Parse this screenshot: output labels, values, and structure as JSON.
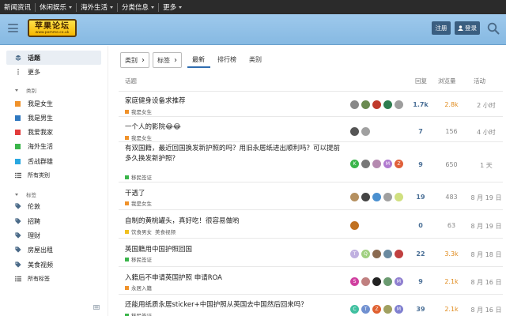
{
  "topnav": {
    "items": [
      {
        "label": "新闻资讯"
      },
      {
        "label": "休闲娱乐"
      },
      {
        "label": "海外生活"
      },
      {
        "label": "分类信息"
      },
      {
        "label": "更多"
      }
    ]
  },
  "header": {
    "logo_text": "苹果论坛",
    "logo_sub": "www.pomme.co.uk",
    "register_label": "注册",
    "login_label": "登录"
  },
  "sidebar": {
    "topics": "话题",
    "more": "更多",
    "categories_head": "类别",
    "categories": [
      {
        "label": "我是女生",
        "color": "#f0922b"
      },
      {
        "label": "我是男生",
        "color": "#2f78c0"
      },
      {
        "label": "我爱我家",
        "color": "#e23b3b"
      },
      {
        "label": "海外生活",
        "color": "#3ab54a"
      },
      {
        "label": "舌战群雄",
        "color": "#28a7e0"
      }
    ],
    "all_categories": "所有类别",
    "tags_head": "标签",
    "tags": [
      {
        "label": "伦敦"
      },
      {
        "label": "招聘"
      },
      {
        "label": "理财"
      },
      {
        "label": "房屋出租"
      },
      {
        "label": "美食视频"
      }
    ],
    "all_tags": "所有标签"
  },
  "filters": {
    "category_label": "类别",
    "tags_label": "标签"
  },
  "tabs": [
    {
      "label": "最新"
    },
    {
      "label": "排行榜"
    },
    {
      "label": "类别"
    }
  ],
  "table": {
    "headers": {
      "topic": "话题",
      "replies": "回复",
      "views": "浏览量",
      "activity": "活动"
    },
    "rows": [
      {
        "title": "家庭健身设备求推荐",
        "tags": [
          {
            "label": "我是女生",
            "color": "#f0922b"
          }
        ],
        "replies": "1.7k",
        "views": "2.8k",
        "views_hot": true,
        "activity": "2 小时",
        "avatars": [
          {
            "icon": "avatar-photo",
            "color": "#888"
          },
          {
            "icon": "avatar-photo",
            "color": "#6a8a50"
          },
          {
            "icon": "avatar-photo",
            "color": "#c0392b"
          },
          {
            "icon": "avatar-photo",
            "color": "#2e7d4f"
          },
          {
            "icon": "avatar-photo",
            "color": "#9e9e9e"
          }
        ]
      },
      {
        "title": "一个人的影院😂😂",
        "tags": [
          {
            "label": "我是女生",
            "color": "#f0922b"
          }
        ],
        "replies": "7",
        "views": "156",
        "views_hot": false,
        "activity": "4 小时",
        "avatars": [
          {
            "icon": "avatar-photo",
            "color": "#555"
          },
          {
            "icon": "avatar-photo",
            "color": "#a0a0a0"
          }
        ]
      },
      {
        "title": "有双国籍，最近回国换发新护照的吗？用旧永居纸进出顺利吗？可以提前多久换发新护照？",
        "tags": [
          {
            "label": "移民签证",
            "color": "#3ab54a"
          }
        ],
        "replies": "9",
        "views": "650",
        "views_hot": false,
        "activity": "1 天",
        "avatars": [
          {
            "letter": "K",
            "color": "#3ab54a"
          },
          {
            "icon": "avatar-photo",
            "color": "#777"
          },
          {
            "icon": "avatar-photo",
            "color": "#b58ab0"
          },
          {
            "letter": "M",
            "color": "#b07ad0"
          },
          {
            "letter": "Z",
            "color": "#e0603a"
          }
        ]
      },
      {
        "title": "干透了",
        "tags": [
          {
            "label": "我是女生",
            "color": "#f0922b"
          }
        ],
        "replies": "19",
        "views": "483",
        "views_hot": false,
        "activity": "8 月 19 日",
        "avatars": [
          {
            "icon": "avatar-photo",
            "color": "#b59060"
          },
          {
            "icon": "avatar-photo",
            "color": "#444"
          },
          {
            "icon": "avatar-photo",
            "color": "#4a90d0"
          },
          {
            "icon": "avatar-photo",
            "color": "#a0a0a0"
          },
          {
            "icon": "avatar-photo",
            "color": "#d0e080"
          }
        ]
      },
      {
        "title": "自制的黄桃罐头，真好吃！很容易做哟",
        "tags": [
          {
            "label": "饮食男女",
            "color": "#f0c020"
          },
          {
            "label": "美食视频",
            "color": null
          }
        ],
        "replies": "0",
        "views": "63",
        "views_hot": false,
        "activity": "8 月 19 日",
        "avatars": [
          {
            "icon": "avatar-photo",
            "color": "#c07020"
          }
        ]
      },
      {
        "title": "英国籍用中国护照回国",
        "tags": [
          {
            "label": "移民签证",
            "color": "#3ab54a"
          }
        ],
        "replies": "22",
        "views": "3.3k",
        "views_hot": true,
        "activity": "8 月 18 日",
        "avatars": [
          {
            "letter": "T",
            "color": "#c0b0e0"
          },
          {
            "letter": "Q",
            "color": "#a0d080"
          },
          {
            "icon": "avatar-photo",
            "color": "#8a6a50"
          },
          {
            "icon": "avatar-photo",
            "color": "#6a8aa0"
          },
          {
            "icon": "avatar-photo",
            "color": "#c04040"
          }
        ]
      },
      {
        "title": "入籍后不申请英国护照 申请ROA",
        "tags": [
          {
            "label": "永居入籍",
            "color": "#f0922b"
          }
        ],
        "replies": "9",
        "views": "2.1k",
        "views_hot": true,
        "activity": "8 月 16 日",
        "avatars": [
          {
            "letter": "S",
            "color": "#d040a0"
          },
          {
            "icon": "avatar-photo",
            "color": "#c08080"
          },
          {
            "icon": "avatar-photo",
            "color": "#222"
          },
          {
            "icon": "avatar-photo",
            "color": "#6a9a70"
          },
          {
            "letter": "M",
            "color": "#9080d0"
          }
        ]
      },
      {
        "title": "还能用纸质永居sticker+中国护照从英国去中国然后回来吗？",
        "tags": [
          {
            "label": "移民签证",
            "color": "#3ab54a"
          }
        ],
        "replies": "39",
        "views": "2.1k",
        "views_hot": true,
        "activity": "8 月 16 日",
        "avatars": [
          {
            "letter": "C",
            "color": "#40c0a0"
          },
          {
            "letter": "T",
            "color": "#7090d0"
          },
          {
            "letter": "Z",
            "color": "#e06030"
          },
          {
            "icon": "avatar-photo",
            "color": "#a0a060"
          },
          {
            "letter": "M",
            "color": "#8080d0"
          }
        ]
      }
    ]
  }
}
